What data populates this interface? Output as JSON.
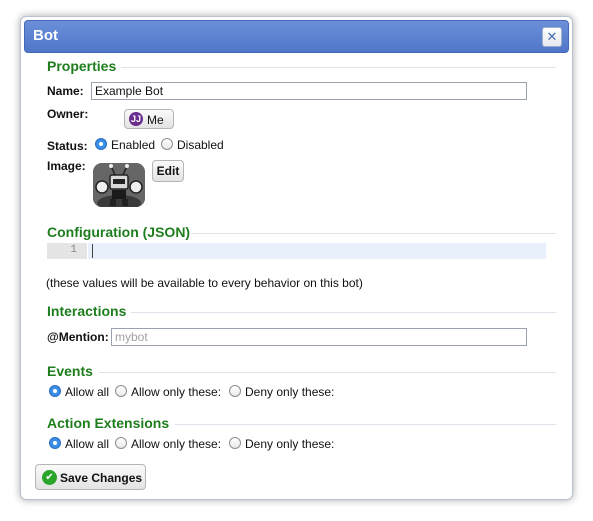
{
  "dialog": {
    "title": "Bot",
    "close_icon": "close-icon"
  },
  "properties": {
    "heading": "Properties",
    "name_label": "Name:",
    "name_value": "Example Bot",
    "owner_label": "Owner:",
    "owner_avatar": "JJ",
    "owner_button": "Me",
    "status_label": "Status:",
    "status_options": [
      "Enabled",
      "Disabled"
    ],
    "status_selected": "Enabled",
    "image_label": "Image:",
    "image_icon": "robot-icon",
    "edit_button": "Edit"
  },
  "configuration": {
    "heading": "Configuration (JSON)",
    "line_number": "1",
    "code": "",
    "hint": "(these values will be available to every behavior on this bot)"
  },
  "interactions": {
    "heading": "Interactions",
    "mention_label": "@Mention:",
    "mention_placeholder": "mybot",
    "mention_value": ""
  },
  "events": {
    "heading": "Events",
    "options": [
      "Allow all",
      "Allow only these:",
      "Deny only these:"
    ],
    "selected": "Allow all"
  },
  "action_extensions": {
    "heading": "Action Extensions",
    "options": [
      "Allow all",
      "Allow only these:",
      "Deny only these:"
    ],
    "selected": "Allow all"
  },
  "footer": {
    "save_button": "Save Changes",
    "save_icon": "checkmark-icon"
  },
  "colors": {
    "titlebar": "#5b80cf",
    "section_heading": "#1e7e1e",
    "radio_selected": "#3a8ee6",
    "save_check": "#2aa52a"
  }
}
